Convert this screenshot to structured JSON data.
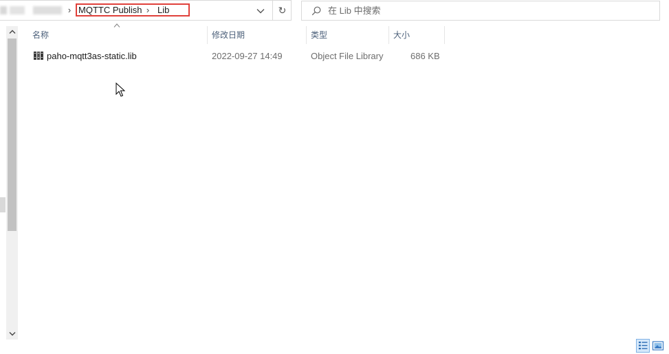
{
  "address_bar": {
    "breadcrumbs": [
      "MQTTC Publish",
      "Lib"
    ],
    "separator": "›",
    "highlight_color": "#e0403a"
  },
  "refresh": {
    "icon": "refresh-icon",
    "glyph": "↻"
  },
  "search": {
    "placeholder": "在 Lib 中搜索",
    "value": ""
  },
  "columns": {
    "name": "名称",
    "date": "修改日期",
    "type": "类型",
    "size": "大小"
  },
  "files": [
    {
      "name": "paho-mqtt3as-static.lib",
      "date": "2022-09-27 14:49",
      "type": "Object File Library",
      "size": "686 KB",
      "icon": "library-file-icon"
    }
  ],
  "view": {
    "active": "details"
  }
}
